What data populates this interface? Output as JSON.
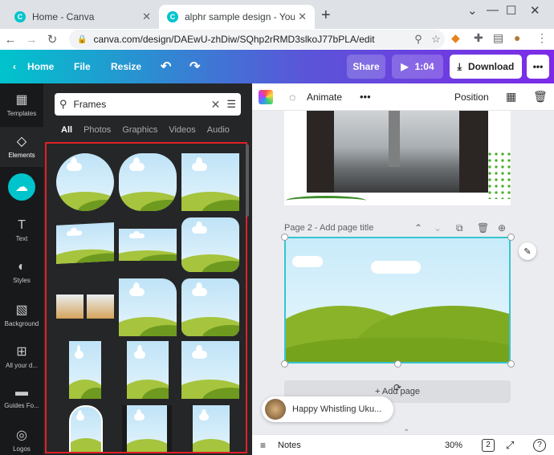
{
  "browser": {
    "tabs": [
      {
        "title": "Home - Canva"
      },
      {
        "title": "alphr sample design - YouTube T"
      }
    ],
    "new_tab": "+",
    "url": "canva.com/design/DAEwU-zhDiw/SQhp2rRMD3slkoJ77bPLA/edit"
  },
  "header": {
    "home": "Home",
    "file": "File",
    "resize": "Resize",
    "share": "Share",
    "play_time": "1:04",
    "download": "Download",
    "more": "•••"
  },
  "rail": {
    "items": [
      {
        "label": "Templates"
      },
      {
        "label": "Elements"
      },
      {
        "label": ""
      },
      {
        "label": "Text"
      },
      {
        "label": "Styles"
      },
      {
        "label": "Background"
      },
      {
        "label": "All your d..."
      },
      {
        "label": "Guides Fo..."
      },
      {
        "label": "Logos"
      }
    ]
  },
  "panel": {
    "search_value": "Frames",
    "categories": [
      "All",
      "Photos",
      "Graphics",
      "Videos",
      "Audio"
    ]
  },
  "editor_toolbar": {
    "animate": "Animate",
    "more": "•••",
    "position": "Position"
  },
  "canvas": {
    "page2_label": "Page 2 - Add page title",
    "add_page": "+ Add page",
    "music_title": "Happy Whistling Uku..."
  },
  "footer": {
    "notes": "Notes",
    "zoom": "30%",
    "page_count": "2"
  },
  "colors": {
    "header_start": "#00c4cc",
    "header_end": "#7d2ae8",
    "highlight_border": "#e0202a",
    "selection": "#36c5d0"
  }
}
